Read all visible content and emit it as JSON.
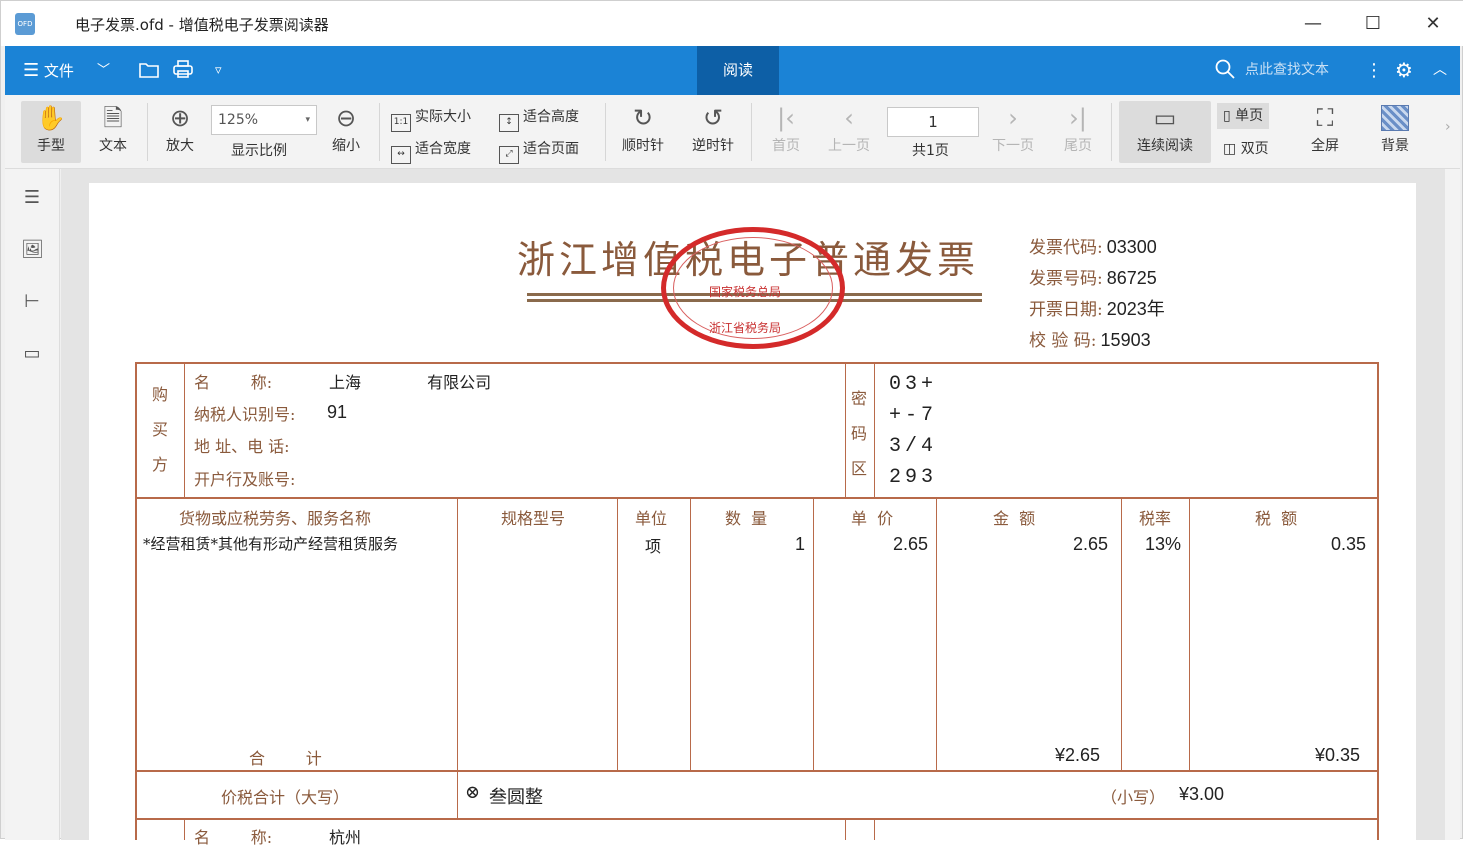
{
  "window": {
    "title": "电子发票.ofd - 增值税电子发票阅读器",
    "app_icon_text": "OFD",
    "minimize": "—",
    "maximize": "☐",
    "close": "✕"
  },
  "menubar": {
    "file_label": "文件",
    "read_tab": "阅读",
    "search_placeholder": "点此查找文本"
  },
  "toolbar": {
    "hand": "手型",
    "text": "文本",
    "zoom_in": "放大",
    "zoom_value": "125%",
    "zoom_label": "显示比例",
    "zoom_out": "缩小",
    "actual_size": "实际大小",
    "fit_height": "适合高度",
    "fit_width": "适合宽度",
    "fit_page": "适合页面",
    "rotate_cw": "顺时针",
    "rotate_ccw": "逆时针",
    "first_page": "首页",
    "prev_page": "上一页",
    "current_page": "1",
    "total_pages": "共1页",
    "next_page": "下一页",
    "last_page": "尾页",
    "continuous": "连续阅读",
    "single_page": "单页",
    "double_page": "双页",
    "fullscreen": "全屏",
    "background": "背景"
  },
  "invoice": {
    "title": "浙江增值税电子普通发票",
    "stamp_line1": "国家税务总局",
    "stamp_line2": "浙江省税务局",
    "code_label": "发票代码:",
    "code_value": "03300",
    "number_label": "发票号码:",
    "number_value": "86725",
    "date_label": "开票日期:",
    "date_value": "2023年",
    "check_label": "校 验 码:",
    "check_value": "15903",
    "buyer_side": [
      "购",
      "买",
      "方"
    ],
    "buyer_name_label": "名        称:",
    "buyer_name": "上海             有限公司",
    "buyer_tax_label": "纳税人识别号:",
    "buyer_tax": "91",
    "buyer_addr_label": "地 址、电 话:",
    "buyer_bank_label": "开户行及账号:",
    "cipher_side": [
      "密",
      "码",
      "区"
    ],
    "cipher_lines": [
      "03+",
      "+-7",
      "3/4",
      "293"
    ],
    "headers": {
      "goods": "货物或应税劳务、服务名称",
      "spec": "规格型号",
      "unit": "单位",
      "qty": "数  量",
      "price": "单  价",
      "amount": "金  额",
      "rate": "税率",
      "tax": "税  额"
    },
    "item": {
      "name": "*经营租赁*其他有形动产经营租赁服务",
      "unit": "项",
      "qty": "1",
      "price": "2.65",
      "amount": "2.65",
      "rate": "13%",
      "tax": "0.35"
    },
    "total_label": "合        计",
    "total_amount": "¥2.65",
    "total_tax": "¥0.35",
    "sum_label": "价税合计（大写）",
    "sum_upper": "叁圆整",
    "sum_lower_label": "（小写）",
    "sum_lower": "¥3.00",
    "seller_name_label": "名        称:",
    "seller_name": "杭州"
  }
}
